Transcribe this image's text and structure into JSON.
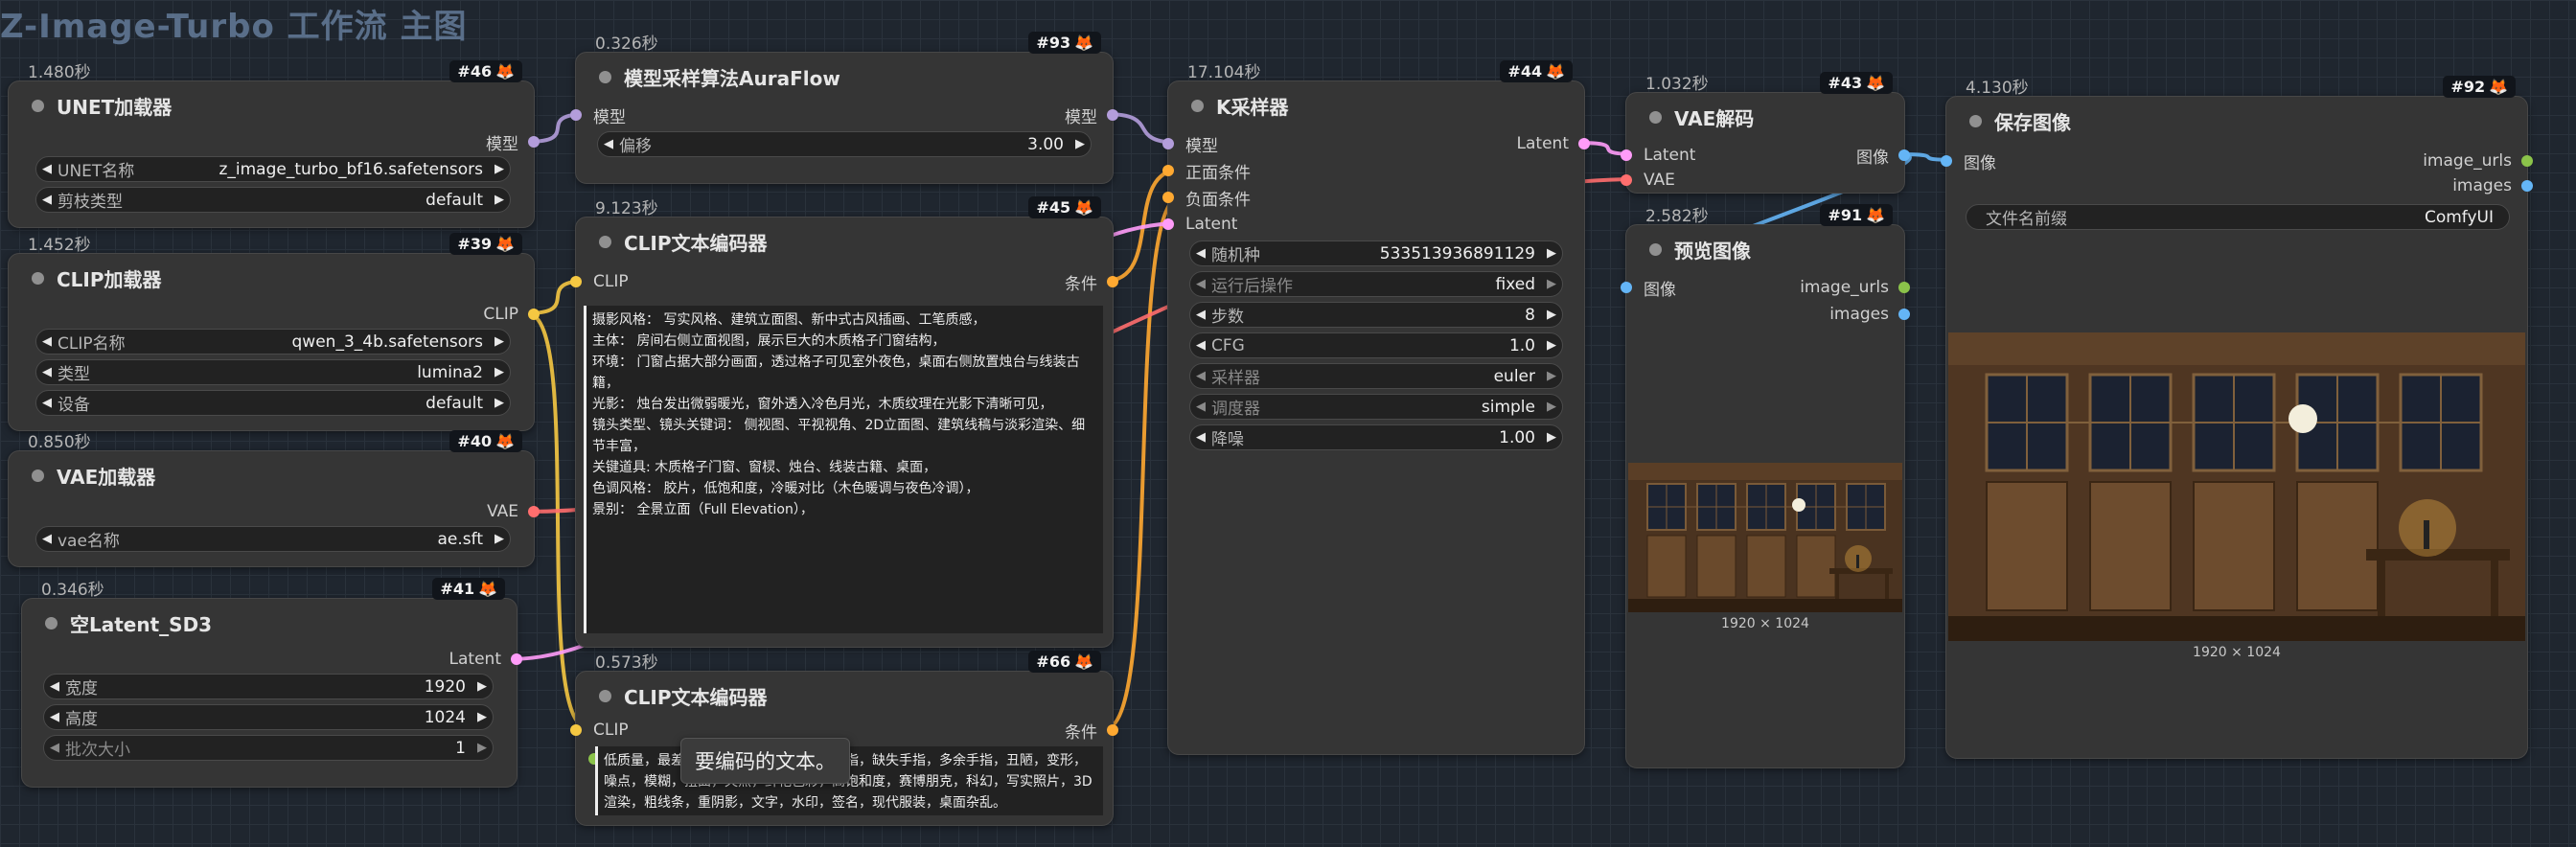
{
  "watermark": "Z-Image-Turbo 工作流 主图",
  "colors": {
    "model": "#b39ddb",
    "clip": "#f5c842",
    "latent": "#ff9cf9",
    "vae": "#ff6e6e",
    "conditioning": "#ffa931",
    "image": "#64b5f6",
    "string": "#8bc34a"
  },
  "nodes": {
    "unet": {
      "time": "1.480秒",
      "id": "#46",
      "title": "UNET加载器",
      "outputs": [
        {
          "label": "模型",
          "type": "model"
        }
      ],
      "widgets": [
        {
          "label": "UNET名称",
          "value": "z_image_turbo_bf16.safetensors"
        },
        {
          "label": "剪枝类型",
          "value": "default"
        }
      ]
    },
    "clip_loader": {
      "time": "1.452秒",
      "id": "#39",
      "title": "CLIP加载器",
      "outputs": [
        {
          "label": "CLIP",
          "type": "clip"
        }
      ],
      "widgets": [
        {
          "label": "CLIP名称",
          "value": "qwen_3_4b.safetensors"
        },
        {
          "label": "类型",
          "value": "lumina2"
        },
        {
          "label": "设备",
          "value": "default"
        }
      ]
    },
    "vae_loader": {
      "time": "0.850秒",
      "id": "#40",
      "title": "VAE加载器",
      "outputs": [
        {
          "label": "VAE",
          "type": "vae"
        }
      ],
      "widgets": [
        {
          "label": "vae名称",
          "value": "ae.sft"
        }
      ]
    },
    "latent": {
      "time": "0.346秒",
      "id": "#41",
      "title": "空Latent_SD3",
      "outputs": [
        {
          "label": "Latent",
          "type": "latent"
        }
      ],
      "widgets": [
        {
          "label": "宽度",
          "value": "1920"
        },
        {
          "label": "高度",
          "value": "1024"
        },
        {
          "label": "批次大小",
          "value": "1"
        }
      ]
    },
    "auraflow": {
      "time": "0.326秒",
      "id": "#93",
      "title": "模型采样算法AuraFlow",
      "inputs": [
        {
          "label": "模型",
          "type": "model"
        }
      ],
      "outputs": [
        {
          "label": "模型",
          "type": "model"
        }
      ],
      "widgets": [
        {
          "label": "偏移",
          "value": "3.00"
        }
      ]
    },
    "clip_pos": {
      "time": "9.123秒",
      "id": "#45",
      "title": "CLIP文本编码器",
      "inputs": [
        {
          "label": "CLIP",
          "type": "clip"
        }
      ],
      "outputs": [
        {
          "label": "条件",
          "type": "conditioning"
        }
      ],
      "text": "摄影风格： 写实风格、建筑立面图、新中式古风插画、工笔质感，\n主体： 房间右侧立面视图，展示巨大的木质格子门窗结构，\n环境： 门窗占据大部分画面，透过格子可见室外夜色，桌面右侧放置烛台与线装古籍，\n光影： 烛台发出微弱暖光，窗外透入冷色月光，木质纹理在光影下清晰可见，\n镜头类型、镜头关键词： 侧视图、平视视角、2D立面图、建筑线稿与淡彩渲染、细节丰富，\n关键道具: 木质格子门窗、窗棂、烛台、线装古籍、桌面，\n色调风格： 胶片，低饱和度，冷暖对比（木色暖调与夜色冷调），\n景别： 全景立面（Full Elevation），"
    },
    "clip_neg": {
      "time": "0.573秒",
      "id": "#66",
      "title": "CLIP文本编码器",
      "inputs": [
        {
          "label": "CLIP",
          "type": "clip"
        }
      ],
      "outputs": [
        {
          "label": "条件",
          "type": "conditioning"
        }
      ],
      "text": "低质量，最差质量，模糊，变形，多余手指，缺失手指，多余手指，丑陋，变形，噪点，模糊，扭曲，失焦，鲜艳色彩，高饱和度，赛博朋克，科幻，写实照片，3D渲染，粗线条，重阴影，文字，水印，签名，现代服装，桌面杂乱。",
      "tooltip": "要编码的文本。"
    },
    "ksampler": {
      "time": "17.104秒",
      "id": "#44",
      "title": "K采样器",
      "inputs": [
        {
          "label": "模型",
          "type": "model"
        },
        {
          "label": "正面条件",
          "type": "conditioning"
        },
        {
          "label": "负面条件",
          "type": "conditioning"
        },
        {
          "label": "Latent",
          "type": "latent"
        }
      ],
      "outputs": [
        {
          "label": "Latent",
          "type": "latent"
        }
      ],
      "widgets": [
        {
          "label": "随机种",
          "value": "533513936891129"
        },
        {
          "label": "运行后操作",
          "value": "fixed"
        },
        {
          "label": "步数",
          "value": "8"
        },
        {
          "label": "CFG",
          "value": "1.0"
        },
        {
          "label": "采样器",
          "value": "euler"
        },
        {
          "label": "调度器",
          "value": "simple"
        },
        {
          "label": "降噪",
          "value": "1.00"
        }
      ]
    },
    "vae_decode": {
      "time": "1.032秒",
      "id": "#43",
      "title": "VAE解码",
      "inputs": [
        {
          "label": "Latent",
          "type": "latent"
        },
        {
          "label": "VAE",
          "type": "vae"
        }
      ],
      "outputs": [
        {
          "label": "图像",
          "type": "image"
        }
      ]
    },
    "preview": {
      "time": "2.582秒",
      "id": "#91",
      "title": "预览图像",
      "inputs": [
        {
          "label": "图像",
          "type": "image"
        }
      ],
      "outputs": [
        {
          "label": "image_urls",
          "type": "string"
        },
        {
          "label": "images",
          "type": "image"
        }
      ],
      "caption": "1920 × 1024"
    },
    "save": {
      "time": "4.130秒",
      "id": "#92",
      "title": "保存图像",
      "inputs": [
        {
          "label": "图像",
          "type": "image"
        }
      ],
      "outputs": [
        {
          "label": "image_urls",
          "type": "string"
        },
        {
          "label": "images",
          "type": "image"
        }
      ],
      "widgets": [
        {
          "label": "文件名前缀",
          "value": "ComfyUI"
        }
      ],
      "caption": "1920 × 1024"
    }
  }
}
